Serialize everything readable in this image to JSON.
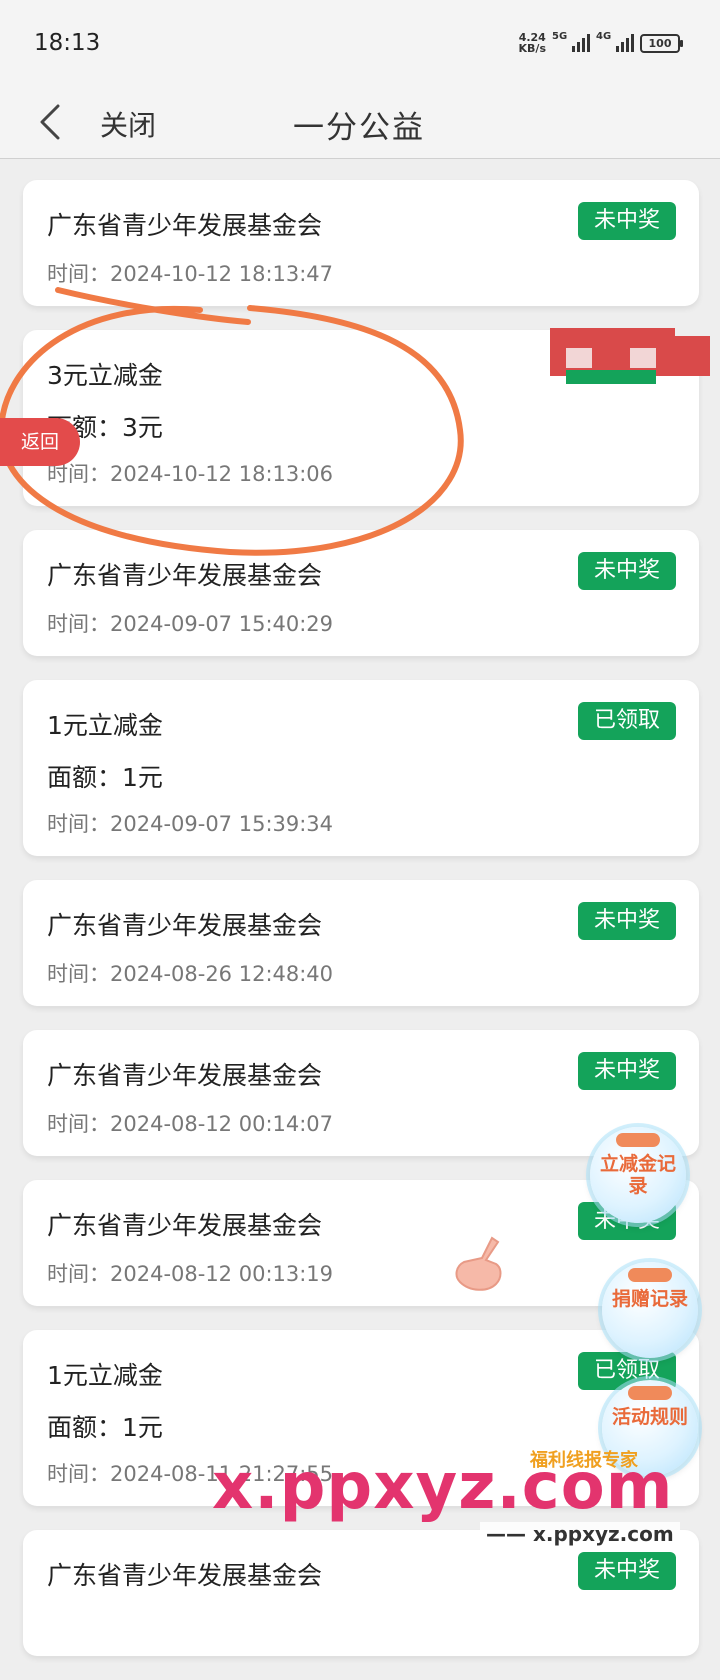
{
  "status_bar": {
    "time": "18:13",
    "net_speed_value": "4.24",
    "net_speed_unit": "KB/s",
    "sim1": "5G",
    "sim2": "4G",
    "battery": "100"
  },
  "nav": {
    "back_icon": "chevron-left-icon",
    "close_label": "关闭",
    "title": "一分公益"
  },
  "records": [
    {
      "title": "广东省青少年发展基金会",
      "badge": "未中奖",
      "time": "时间：2024-10-12 18:13:47"
    },
    {
      "title": "3元立减金",
      "amount": "面额：3元",
      "time": "时间：2024-10-12 18:13:06"
    },
    {
      "title": "广东省青少年发展基金会",
      "badge": "未中奖",
      "time": "时间：2024-09-07 15:40:29"
    },
    {
      "title": "1元立减金",
      "badge": "已领取",
      "amount": "面额：1元",
      "time": "时间：2024-09-07 15:39:34"
    },
    {
      "title": "广东省青少年发展基金会",
      "badge": "未中奖",
      "time": "时间：2024-08-26 12:48:40"
    },
    {
      "title": "广东省青少年发展基金会",
      "badge": "未中奖",
      "time": "时间：2024-08-12 00:14:07"
    },
    {
      "title": "广东省青少年发展基金会",
      "badge": "未中奖",
      "time": "时间：2024-08-12 00:13:19"
    },
    {
      "title": "1元立减金",
      "badge": "已领取",
      "amount": "面额：1元",
      "time": "时间：2024-08-11 21:27:55"
    },
    {
      "title": "广东省青少年发展基金会",
      "badge": "未中奖",
      "time": ""
    }
  ],
  "return_tab": "返回",
  "floating_buttons": {
    "coupon_record": "立减金记录",
    "donation_record": "捐赠记录",
    "activity_rules": "活动规则"
  },
  "watermark": {
    "logo": "x.ppxyz.com",
    "url": "—— x.ppxyz.com",
    "tag": "福利线报专家"
  },
  "colors": {
    "badge_green": "#14a35a",
    "return_red": "#e34b4b",
    "annotation_orange": "#f07a45"
  }
}
